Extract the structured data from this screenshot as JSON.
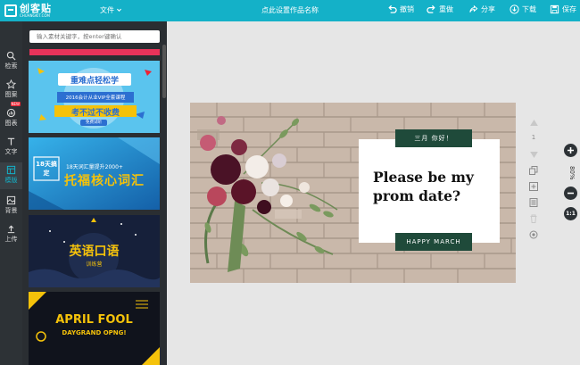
{
  "app": {
    "logo_text": "创客贴",
    "logo_sub": "CHUANGKIT.COM",
    "file_menu": "文件",
    "design_title": "点此设置作品名称",
    "toolbar": {
      "undo": "撤销",
      "redo": "重做",
      "share": "分享",
      "download": "下载",
      "save": "保存"
    }
  },
  "sidebar": {
    "items": [
      {
        "label": "检索",
        "icon": "search-icon"
      },
      {
        "label": "图案",
        "icon": "shape-icon"
      },
      {
        "label": "图表",
        "icon": "chart-icon",
        "badge": "NEW"
      },
      {
        "label": "文字",
        "icon": "text-icon"
      },
      {
        "label": "模版",
        "icon": "template-icon",
        "active": true
      },
      {
        "label": "背景",
        "icon": "background-icon"
      },
      {
        "label": "上传",
        "icon": "upload-icon"
      }
    ]
  },
  "panel": {
    "search_placeholder": "输入素材关键字，按enter键确认",
    "templates": [
      {
        "line1": "重难点轻松学",
        "line2": "2016会计从业VIP全套课程",
        "line3": "考不过不收费",
        "line4": "免费试听"
      },
      {
        "tag": "18天搞定",
        "line1": "18天词汇量提升2000+",
        "line2": "托福核心词汇"
      },
      {
        "line1": "英语口语",
        "line2": "训练营"
      },
      {
        "line1": "APRIL FOOL",
        "line2": "DAYGRAND OPNG!"
      }
    ]
  },
  "design": {
    "date_tag": "三月 你好！",
    "headline_line1": "Please be my",
    "headline_line2": "prom date?",
    "footer_tag": "HAPPY MARCH"
  },
  "right_tools": {
    "page_number": "1"
  },
  "zoom": {
    "value": "80%",
    "fit_label": "1:1"
  },
  "colors": {
    "accent": "#14b1c8",
    "sidebar_bg": "#2d3236",
    "panel_bg": "#2a2e32",
    "card_tag": "#1f4a3a"
  }
}
